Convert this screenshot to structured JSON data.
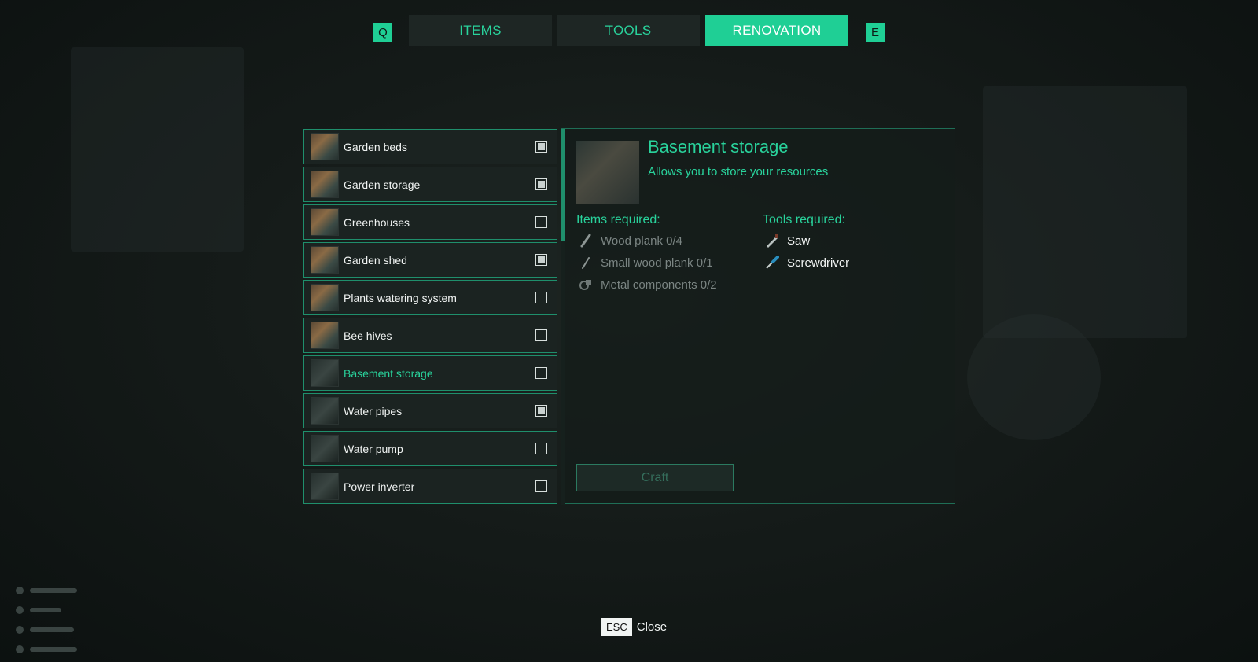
{
  "tabs": {
    "prev_key": "Q",
    "next_key": "E",
    "items": [
      {
        "label": "ITEMS",
        "active": false
      },
      {
        "label": "TOOLS",
        "active": false
      },
      {
        "label": "RENOVATION",
        "active": true
      }
    ]
  },
  "recipes": [
    {
      "label": "Garden beds",
      "checked": true,
      "icon": "garden-beds-thumbnail"
    },
    {
      "label": "Garden storage",
      "checked": true,
      "icon": "garden-storage-thumbnail"
    },
    {
      "label": "Greenhouses",
      "checked": false,
      "icon": "greenhouses-thumbnail"
    },
    {
      "label": "Garden shed",
      "checked": true,
      "icon": "garden-shed-thumbnail"
    },
    {
      "label": "Plants watering system",
      "checked": false,
      "icon": "watering-system-thumbnail"
    },
    {
      "label": "Bee hives",
      "checked": false,
      "icon": "bee-hives-thumbnail"
    },
    {
      "label": "Basement storage",
      "checked": false,
      "selected": true,
      "icon": "basement-storage-thumbnail"
    },
    {
      "label": "Water pipes",
      "checked": true,
      "icon": "water-pipes-thumbnail"
    },
    {
      "label": "Water pump",
      "checked": false,
      "icon": "water-pump-thumbnail"
    },
    {
      "label": "Power inverter",
      "checked": false,
      "icon": "power-inverter-thumbnail"
    }
  ],
  "detail": {
    "title": "Basement storage",
    "description": "Allows you to store your resources",
    "items_heading": "Items required:",
    "tools_heading": "Tools required:",
    "items_required": [
      {
        "label": "Wood plank 0/4",
        "icon": "wood-plank-icon"
      },
      {
        "label": "Small wood plank 0/1",
        "icon": "small-wood-plank-icon"
      },
      {
        "label": "Metal components 0/2",
        "icon": "metal-components-icon"
      }
    ],
    "tools_required": [
      {
        "label": "Saw",
        "icon": "saw-icon"
      },
      {
        "label": "Screwdriver",
        "icon": "screwdriver-icon"
      }
    ],
    "craft_label": "Craft"
  },
  "footer": {
    "esc_key": "ESC",
    "close_label": "Close"
  },
  "colors": {
    "accent": "#1fcf95",
    "accent_text": "#29d39c",
    "panel_border": "#1f8f6c",
    "missing_text": "#7b8583"
  }
}
